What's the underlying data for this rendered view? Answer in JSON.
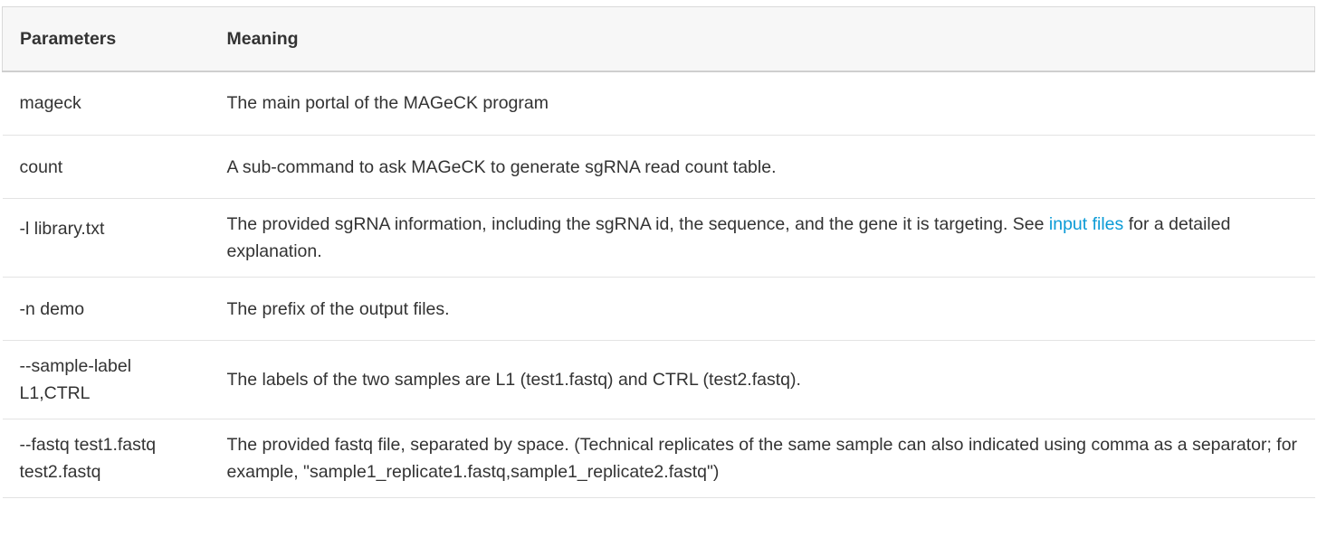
{
  "table": {
    "headers": [
      "Parameters",
      "Meaning"
    ],
    "rows": [
      {
        "param": "mageck",
        "meaning": "The main portal of the MAGeCK program"
      },
      {
        "param": "count",
        "meaning": "A sub-command to ask MAGeCK to generate sgRNA read count table."
      },
      {
        "param": "-l library.txt",
        "meaning_before": "The provided sgRNA information, including the sgRNA id, the sequence, and the gene it is targeting. See ",
        "link_text": "input files",
        "meaning_after": " for a detailed explanation."
      },
      {
        "param": "-n demo",
        "meaning": "The prefix of the output files."
      },
      {
        "param_line1": "--sample-label",
        "param_line2": "L1,CTRL",
        "meaning": "The labels of the two samples are L1 (test1.fastq) and CTRL (test2.fastq)."
      },
      {
        "param_line1": "--fastq test1.fastq",
        "param_line2": "test2.fastq",
        "meaning": "The provided fastq file, separated by space. (Technical replicates of the same sample can also indicated using comma as a separator; for example, \"sample1_replicate1.fastq,sample1_replicate2.fastq\")"
      }
    ]
  },
  "colors": {
    "header_bg": "#f7f7f7",
    "text": "#333333",
    "link": "#0b9bd6",
    "border": "#e3e3e3"
  }
}
